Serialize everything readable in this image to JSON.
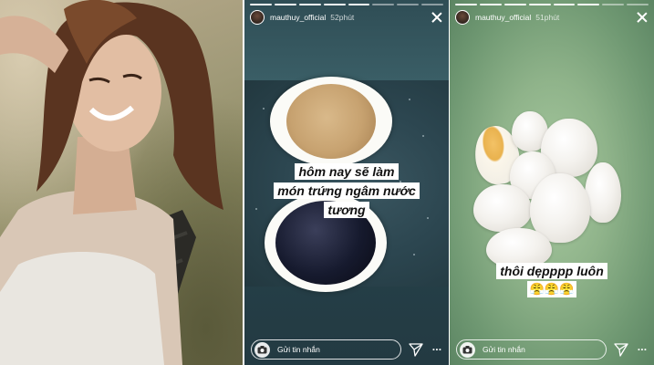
{
  "stories": [
    {
      "username": "mauthuy_official",
      "time": "52phút",
      "caption_lines": [
        "hôm nay sẽ làm",
        "món trứng ngâm nước",
        "tương"
      ],
      "reply_placeholder": "Gửi tin nhắn",
      "more": "···"
    },
    {
      "username": "mauthuy_official",
      "time": "51phút",
      "caption_lines": [
        "thôi dẹpppp luôn"
      ],
      "emojis": "😤😤😤",
      "reply_placeholder": "Gửi tin nhắn",
      "more": "···"
    }
  ],
  "icons": {
    "close": "close-icon",
    "camera": "camera-icon",
    "send": "send-icon",
    "more": "more-icon"
  },
  "colors": {
    "story1_bg": "#2f4d55",
    "story2_bg": "#8fb38a",
    "caption_bg": "#ffffff"
  }
}
